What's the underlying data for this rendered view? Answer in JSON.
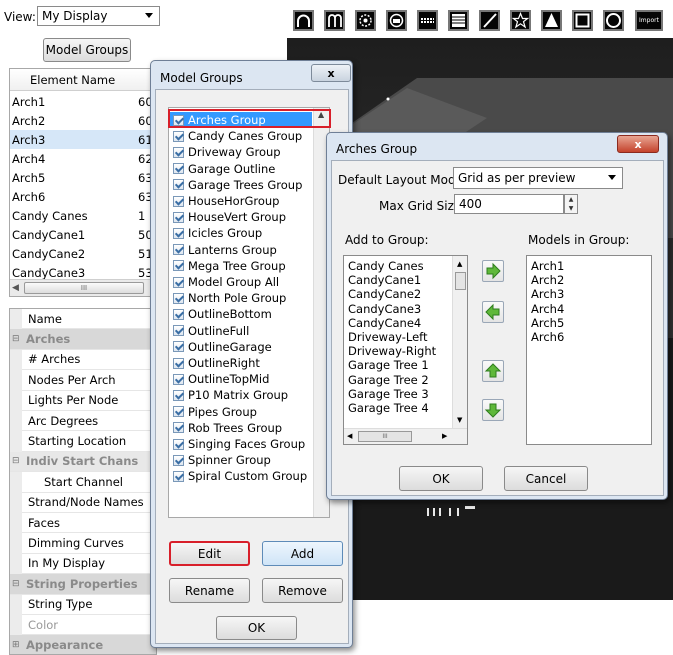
{
  "top": {
    "view_label": "View:",
    "view_value": "My Display",
    "model_groups_button": "Model Groups"
  },
  "element_list": {
    "header": "Element Name",
    "rows": [
      {
        "name": "Arch1",
        "val": "60"
      },
      {
        "name": "Arch2",
        "val": "60"
      },
      {
        "name": "Arch3",
        "val": "61"
      },
      {
        "name": "Arch4",
        "val": "62"
      },
      {
        "name": "Arch5",
        "val": "63"
      },
      {
        "name": "Arch6",
        "val": "63"
      },
      {
        "name": "Candy Canes",
        "val": "1"
      },
      {
        "name": "CandyCane1",
        "val": "50"
      },
      {
        "name": "CandyCane2",
        "val": "51"
      },
      {
        "name": "CandyCane3",
        "val": "53"
      }
    ],
    "scroll_grip": "III"
  },
  "properties": {
    "rows": [
      {
        "label": "Name",
        "type": "normal"
      },
      {
        "label": "Arches",
        "type": "section"
      },
      {
        "label": "# Arches",
        "type": "child"
      },
      {
        "label": "Nodes Per Arch",
        "type": "child"
      },
      {
        "label": "Lights Per Node",
        "type": "child"
      },
      {
        "label": "Arc Degrees",
        "type": "child"
      },
      {
        "label": "Starting Location",
        "type": "child"
      },
      {
        "label": "Indiv Start Chans",
        "type": "section-gray"
      },
      {
        "label": "Start Channel",
        "type": "child2"
      },
      {
        "label": "Strand/Node Names",
        "type": "child"
      },
      {
        "label": "Faces",
        "type": "child"
      },
      {
        "label": "Dimming Curves",
        "type": "child"
      },
      {
        "label": "In My Display",
        "type": "child"
      },
      {
        "label": "String Properties",
        "type": "section"
      },
      {
        "label": "String Type",
        "type": "child"
      },
      {
        "label": "Color",
        "type": "child-gray"
      },
      {
        "label": "Appearance",
        "type": "section-plus"
      }
    ]
  },
  "toolbar": {
    "icons": [
      "arch-icon",
      "candy-cane-icon",
      "circle-icon",
      "star-burst-icon",
      "matrix-horizontal-icon",
      "matrix-icon",
      "single-line-icon",
      "star-icon",
      "tree-icon",
      "window-frame-icon",
      "circle-outline-icon"
    ],
    "import_label": "Import"
  },
  "model_groups_dialog": {
    "title": "Model Groups",
    "close": "x",
    "groups": [
      "Arches Group",
      "Candy Canes Group",
      "Driveway Group",
      "Garage Outline",
      "Garage Trees Group",
      "HouseHorGroup",
      "HouseVert Group",
      "Icicles Group",
      "Lanterns Group",
      "Mega Tree Group",
      "Model Group All",
      "North Pole Group",
      "OutlineBottom",
      "OutlineFull",
      "OutlineGarage",
      "OutlineRight",
      "OutlineTopMid",
      "P10 Matrix Group",
      "Pipes Group",
      "Rob Trees Group",
      "Singing Faces Group",
      "Spinner Group",
      "Spiral Custom Group"
    ],
    "edit_button": "Edit",
    "add_button": "Add",
    "rename_button": "Rename",
    "remove_button": "Remove",
    "ok_button": "OK"
  },
  "arches_dialog": {
    "title": "Arches Group",
    "close": "x",
    "layout_mode_label": "Default Layout Mode:",
    "layout_mode_value": "Grid as per preview",
    "max_grid_label": "Max Grid Size:",
    "max_grid_value": "400",
    "add_to_group_label": "Add to Group:",
    "models_in_group_label": "Models in Group:",
    "available": [
      "Candy Canes",
      "CandyCane1",
      "CandyCane2",
      "CandyCane3",
      "CandyCane4",
      "Driveway-Left",
      "Driveway-Right",
      "Garage Tree 1",
      "Garage Tree 2",
      "Garage Tree 3",
      "Garage Tree 4"
    ],
    "in_group": [
      "Arch1",
      "Arch2",
      "Arch3",
      "Arch4",
      "Arch5",
      "Arch6"
    ],
    "scroll_grip": "III",
    "ok_button": "OK",
    "cancel_button": "Cancel"
  },
  "colors": {
    "highlight": "#d81f2a",
    "selection": "#3399ff",
    "arrow_green": "#4caf2a"
  }
}
